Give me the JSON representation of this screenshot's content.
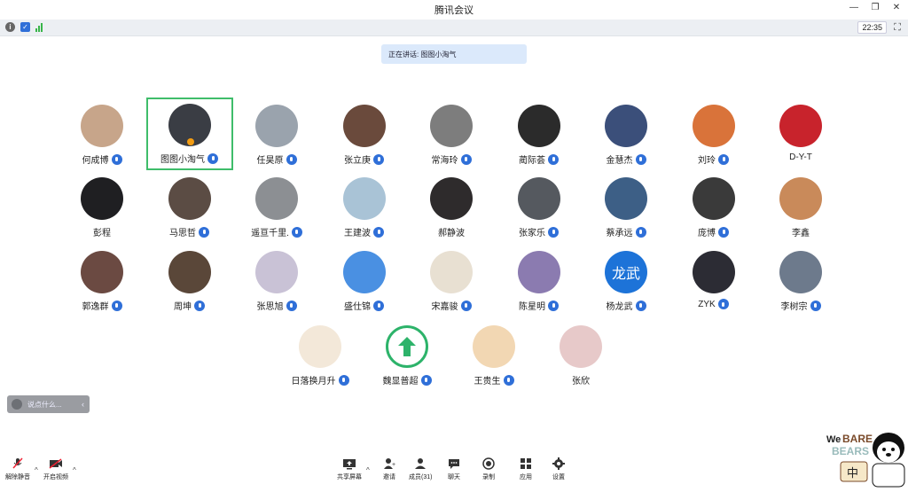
{
  "window": {
    "title": "腾讯会议"
  },
  "status": {
    "time": "22:35"
  },
  "speaking": {
    "text": "正在讲话: 图图小淘气"
  },
  "participants": [
    {
      "name": "何成博",
      "mic": true,
      "color": "#c7a58a"
    },
    {
      "name": "图图小淘气",
      "mic": true,
      "color": "#3a3d44",
      "active": true
    },
    {
      "name": "任昊原",
      "mic": true,
      "color": "#9aa3ad"
    },
    {
      "name": "张立庚",
      "mic": true,
      "color": "#6a4a3c"
    },
    {
      "name": "常海玲",
      "mic": true,
      "color": "#7d7d7d"
    },
    {
      "name": "蔺际荟",
      "mic": true,
      "color": "#2b2b2b"
    },
    {
      "name": "金慧杰",
      "mic": true,
      "color": "#3b4f7a"
    },
    {
      "name": "刘玲",
      "mic": true,
      "color": "#d9733a"
    },
    {
      "name": "D-Y-T",
      "mic": false,
      "color": "#c8232c"
    },
    {
      "name": "彭程",
      "mic": false,
      "color": "#1f1f22"
    },
    {
      "name": "马思哲",
      "mic": true,
      "color": "#5b4c44"
    },
    {
      "name": "遥亘千里.",
      "mic": true,
      "color": "#8c8f93"
    },
    {
      "name": "王建波",
      "mic": true,
      "color": "#a9c3d6"
    },
    {
      "name": "郝静波",
      "mic": false,
      "color": "#2e2b2c"
    },
    {
      "name": "张家乐",
      "mic": true,
      "color": "#55595f"
    },
    {
      "name": "蔡承远",
      "mic": true,
      "color": "#3d5f86"
    },
    {
      "name": "庞博",
      "mic": true,
      "color": "#3a3a3a"
    },
    {
      "name": "李鑫",
      "mic": false,
      "color": "#c98a5a"
    },
    {
      "name": "郭逸群",
      "mic": true,
      "color": "#6b4a42"
    },
    {
      "name": "周坤",
      "mic": true,
      "color": "#5a4739"
    },
    {
      "name": "张思旭",
      "mic": true,
      "color": "#c9c2d6"
    },
    {
      "name": "盛仕锦",
      "mic": true,
      "color": "#4a90e2"
    },
    {
      "name": "宋嘉骏",
      "mic": true,
      "color": "#e8e0d2"
    },
    {
      "name": "陈星明",
      "mic": true,
      "color": "#8b7bb0"
    },
    {
      "name": "杨龙武",
      "mic": true,
      "color": "#1d73d8",
      "text": "龙武"
    },
    {
      "name": "ZYK",
      "mic": true,
      "color": "#2c2c34"
    },
    {
      "name": "李树宗",
      "mic": true,
      "color": "#6d7a8c"
    },
    {
      "name": "日落换月升",
      "mic": true,
      "color": "#f3e8d9"
    },
    {
      "name": "魏显普超",
      "mic": true,
      "color": "#ffffff",
      "arrow": true
    },
    {
      "name": "王贵生",
      "mic": true,
      "color": "#f2d7b3"
    },
    {
      "name": "张欣",
      "mic": false,
      "color": "#e7c9c9"
    }
  ],
  "chat": {
    "placeholder": "说点什么..."
  },
  "toolbar": {
    "unmute": "解除静音",
    "video": "开启视频",
    "share": "共享屏幕",
    "invite": "邀请",
    "members": "成员(31)",
    "chat": "聊天",
    "record": "录制",
    "apps": "应用",
    "settings": "设置"
  },
  "sticker": {
    "brand": "We BARE BEARS",
    "char": "中"
  }
}
